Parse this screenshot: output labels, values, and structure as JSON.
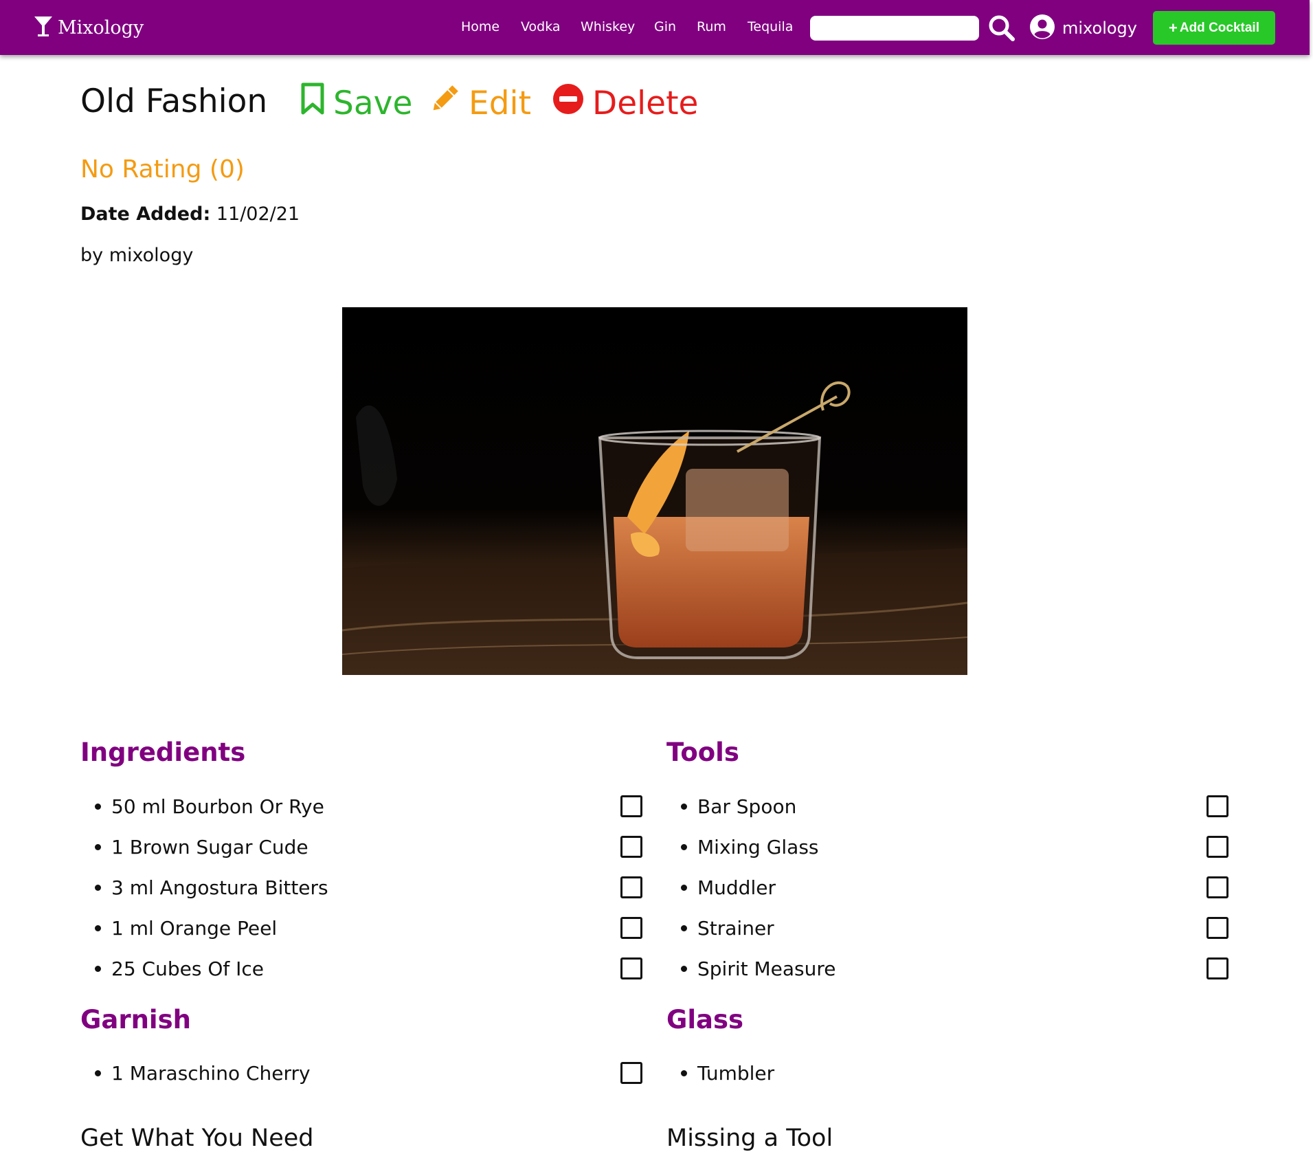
{
  "app": {
    "brand": "Mixology",
    "nav": [
      "Home",
      "Vodka",
      "Whiskey",
      "Gin",
      "Rum",
      "Tequila"
    ],
    "search": {
      "value": "",
      "placeholder": ""
    },
    "username": "mixology",
    "add_button_label": "Add Cocktail"
  },
  "colors": {
    "navbar": "#800080",
    "accent_heading": "#800080",
    "add_button": "#28c828",
    "save": "#2db52d",
    "edit": "#f49b12",
    "delete": "#e61c1c",
    "rating": "#f49b12"
  },
  "cocktail": {
    "name": "Old Fashion",
    "actions": {
      "save": "Save",
      "edit": "Edit",
      "delete": "Delete"
    },
    "rating_text": "No Rating (0)",
    "date_label": "Date Added:",
    "date_value": "11/02/21",
    "byline": "by mixology",
    "image_icon": "cocktail-photo"
  },
  "sections": {
    "ingredients": {
      "title": "Ingredients",
      "items": [
        "50 ml Bourbon Or Rye",
        "1 Brown Sugar Cude",
        "3 ml Angostura Bitters",
        "1 ml Orange Peel",
        "25 Cubes Of Ice"
      ]
    },
    "tools": {
      "title": "Tools",
      "items": [
        "Bar Spoon",
        "Mixing Glass",
        "Muddler",
        "Strainer",
        "Spirit Measure"
      ]
    },
    "garnish": {
      "title": "Garnish",
      "items": [
        "1 Maraschino Cherry"
      ]
    },
    "glass": {
      "title": "Glass",
      "items": [
        "Tumbler"
      ]
    }
  },
  "bottom": {
    "left_heading": "Get What You Need",
    "right_heading": "Missing a Tool"
  }
}
